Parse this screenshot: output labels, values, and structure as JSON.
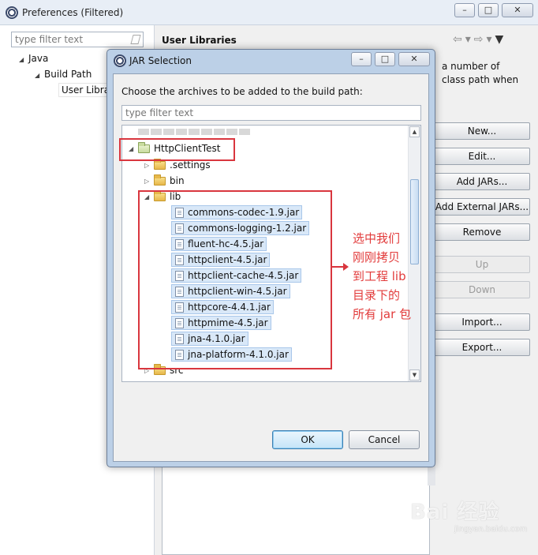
{
  "outer_window": {
    "title": "Preferences (Filtered)",
    "filter_placeholder": "type filter text",
    "tree": {
      "java": "Java",
      "build_path": "Build Path",
      "user_libraries": "User Libra"
    },
    "page_title": "User Libraries",
    "description_lines": [
      "a number of",
      "class path when"
    ],
    "buttons": {
      "new": "New...",
      "edit": "Edit...",
      "add_jars": "Add JARs...",
      "add_external_jars": "Add External JARs...",
      "remove": "Remove",
      "up": "Up",
      "down": "Down",
      "import": "Import...",
      "export": "Export..."
    },
    "win_buttons": {
      "minimize": "–",
      "maximize": "□",
      "close": "✕"
    }
  },
  "dialog": {
    "title": "JAR Selection",
    "instruction": "Choose the archives to be added to the build path:",
    "filter_placeholder": "type filter text",
    "project": "HttpClientTest",
    "folders": {
      "settings": ".settings",
      "bin": "bin",
      "lib": "lib",
      "src": "src"
    },
    "jars": [
      "commons-codec-1.9.jar",
      "commons-logging-1.2.jar",
      "fluent-hc-4.5.jar",
      "httpclient-4.5.jar",
      "httpclient-cache-4.5.jar",
      "httpclient-win-4.5.jar",
      "httpcore-4.4.1.jar",
      "httpmime-4.5.jar",
      "jna-4.1.0.jar",
      "jna-platform-4.1.0.jar"
    ],
    "ok_label": "OK",
    "cancel_label": "Cancel"
  },
  "annotation": {
    "lines": [
      "选中我们",
      "刚刚拷贝",
      "到工程 lib",
      "目录下的",
      "所有 jar 包"
    ],
    "color": "#e23b3b"
  },
  "watermark": {
    "brand": "Bai 经验",
    "url": "jingyan.baidu.com"
  }
}
